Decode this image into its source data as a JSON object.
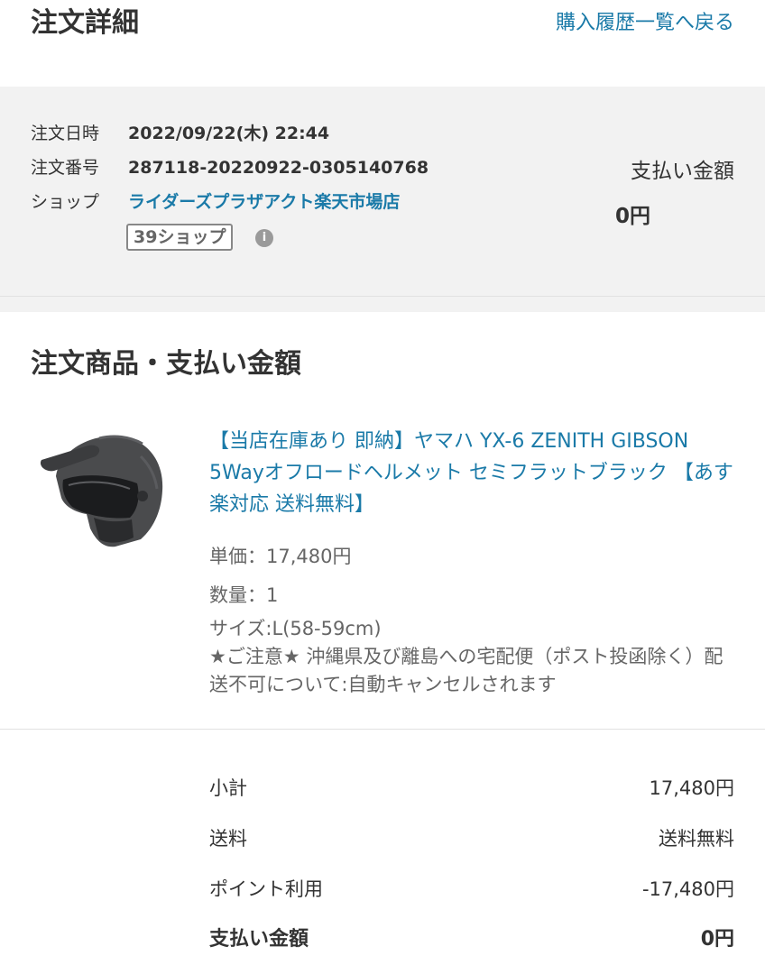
{
  "header": {
    "title": "注文詳細",
    "back_link": "購入履歴一覧へ戻る"
  },
  "order": {
    "date_label": "注文日時",
    "date_value": "2022/09/22(木) 22:44",
    "number_label": "注文番号",
    "number_value": "287118-20220922-0305140768",
    "shop_label": "ショップ",
    "shop_name": "ライダーズプラザアクト楽天市場店",
    "shop_badge": "39ショップ",
    "info_icon_glyph": "i",
    "pay_label": "支払い金額",
    "pay_value": "0円"
  },
  "products": {
    "section_title": "注文商品・支払い金額",
    "item": {
      "image_icon": "helmet-image",
      "name": "【当店在庫あり 即納】ヤマハ YX-6 ZENITH GIBSON 5Wayオフロードヘルメット セミフラットブラック 【あす楽対応 送料無料】",
      "unit_price": "単価：17,480円",
      "quantity": "数量：1",
      "size": "サイズ:L(58-59cm)",
      "notice": "★ご注意★ 沖縄県及び離島への宅配便（ポスト投函除く）配送不可について:自動キャンセルされます"
    }
  },
  "totals": {
    "subtotal_label": "小計",
    "subtotal_value": "17,480円",
    "shipping_label": "送料",
    "shipping_value": "送料無料",
    "points_label": "ポイント利用",
    "points_value": "-17,480円",
    "total_label": "支払い金額",
    "total_value": "0円"
  },
  "colors": {
    "link": "#1a7aa8",
    "summary_bg": "#f2f2f2",
    "text": "#333333",
    "muted": "#666666"
  }
}
